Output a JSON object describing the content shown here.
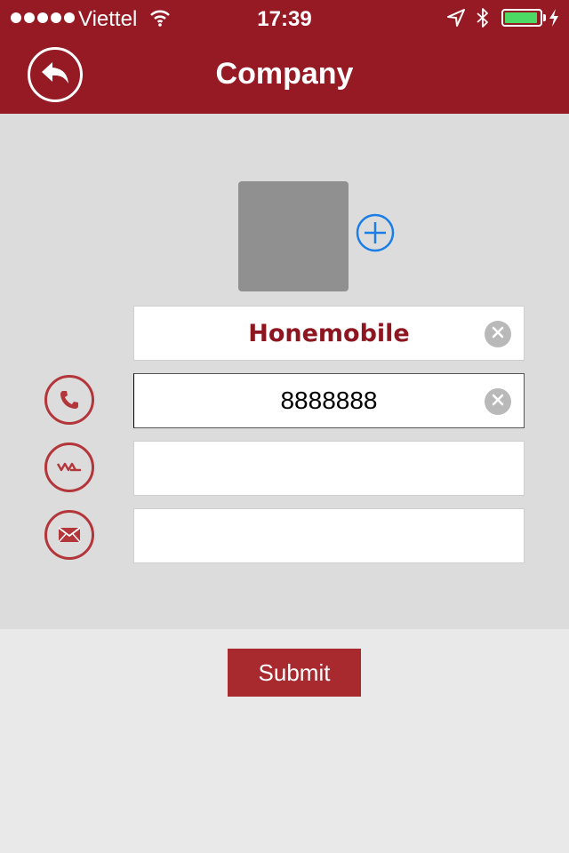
{
  "status_bar": {
    "carrier": "Viettel",
    "time": "17:39",
    "signal_bars": 5,
    "battery_level": 0.95,
    "icons": [
      "wifi-icon",
      "location-arrow-icon",
      "bluetooth-icon",
      "battery-icon",
      "charging-icon"
    ]
  },
  "header": {
    "title": "Company",
    "back_icon": "reply-arrow-icon"
  },
  "form": {
    "add_photo_icon": "plus-circle-icon",
    "fields": [
      {
        "icon": "",
        "value": "Honemobile",
        "placeholder": ""
      },
      {
        "icon": "phone-icon",
        "value": "8888888",
        "placeholder": ""
      },
      {
        "icon": "fax-icon",
        "value": "",
        "placeholder": ""
      },
      {
        "icon": "envelope-icon",
        "value": "",
        "placeholder": ""
      }
    ]
  },
  "actions": {
    "submit_label": "Submit"
  },
  "colors": {
    "brand": "#951a23",
    "accent_blue": "#1a7ee6",
    "form_bg": "#dcdcdc",
    "page_bg": "#e9e9e9"
  }
}
